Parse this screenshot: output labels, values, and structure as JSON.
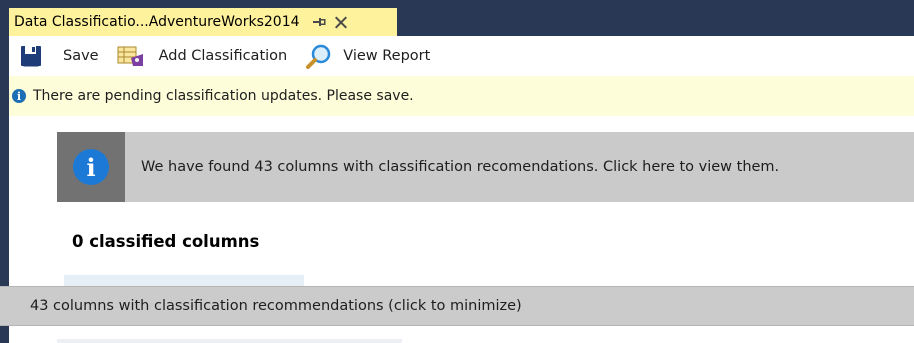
{
  "tab": {
    "title": "Data Classificatio...AdventureWorks2014",
    "pin_icon": "pin-icon",
    "close_icon": "close-icon"
  },
  "toolbar": {
    "save_label": "Save",
    "add_classification_label": "Add Classification",
    "view_report_label": "View Report"
  },
  "infobar": {
    "message": "There are pending classification updates. Please save."
  },
  "banner": {
    "message": "We have found 43 columns with classification recomendations. Click here to view them."
  },
  "classified": {
    "heading": "0 classified columns"
  },
  "recommendations_panel": {
    "label": "43 columns with classification recommendations (click to minimize)"
  },
  "colors": {
    "tab_strip": "#293955",
    "active_tab": "#fff29d",
    "infobar_bg": "#fdfdda",
    "banner_bg": "#cacaca",
    "info_blue": "#1d79d6"
  }
}
